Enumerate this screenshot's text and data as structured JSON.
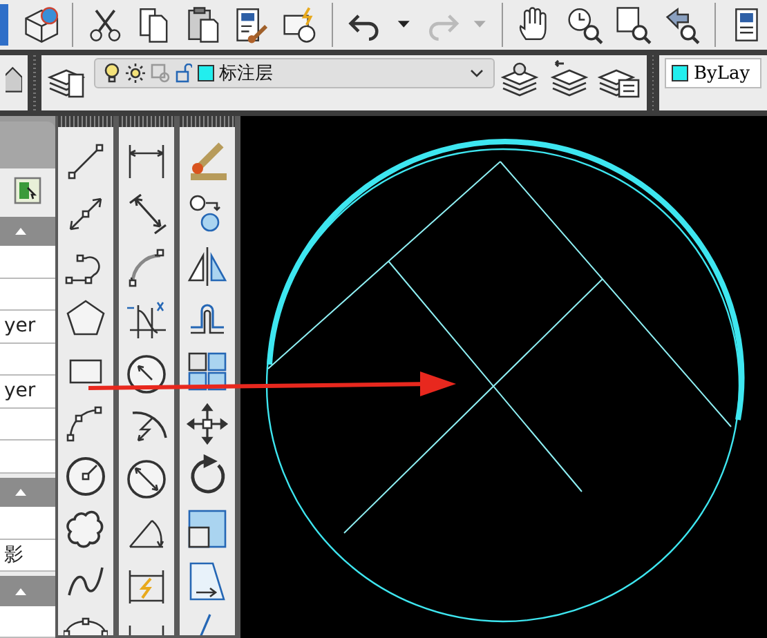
{
  "layer_toolbar": {
    "current_layer": "标注层"
  },
  "color_control": {
    "value": "ByLay"
  },
  "properties_panel": {
    "rows": [
      {
        "kind": "header"
      },
      {
        "kind": "row"
      },
      {
        "kind": "row"
      },
      {
        "kind": "row",
        "text": "yer"
      },
      {
        "kind": "row"
      },
      {
        "kind": "row",
        "text": "yer"
      },
      {
        "kind": "row"
      },
      {
        "kind": "row"
      },
      {
        "kind": "header"
      },
      {
        "kind": "row"
      },
      {
        "kind": "row",
        "text": "影"
      },
      {
        "kind": "header"
      },
      {
        "kind": "row"
      }
    ]
  }
}
